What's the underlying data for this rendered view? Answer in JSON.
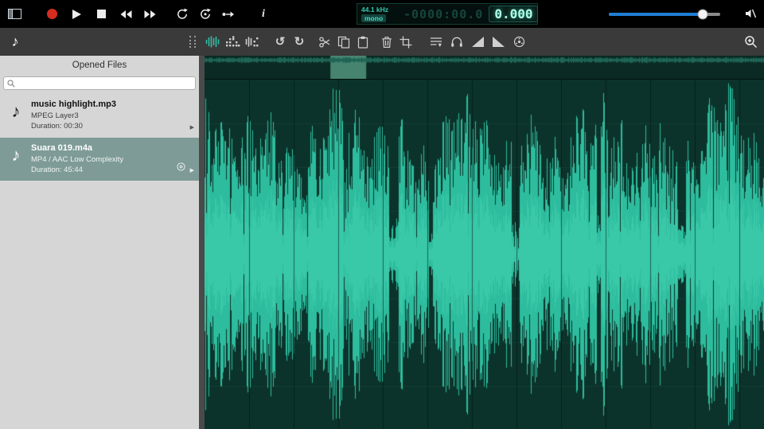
{
  "colors": {
    "accent": "#2fbfa4",
    "record_red": "#d62d20",
    "slider_blue": "#1f7fd4",
    "topbar_bg": "#000000",
    "toolbar2_bg": "#3a3a3a",
    "sidebar_bg": "#d6d6d6",
    "selected_item_bg": "#7e9b97",
    "splitter": "#4a4a4a",
    "wave_bg": "#0c332b",
    "wave_fg": "#2dbd9e",
    "wave_core": "#45d4b2",
    "overview_bg": "#0a2a23",
    "overview_selection": "#47846f",
    "overview_wave": "#1f6455"
  },
  "topbar": {
    "display": {
      "sample_rate": "44.1 kHz",
      "channel_mode": "mono",
      "time_dim": "-0000:00.0",
      "time_bright": "0.000"
    },
    "volume": {
      "level_frac": 0.84
    }
  },
  "toolbar_icons": {
    "music_note": "♪",
    "undo": "↺",
    "redo": "↻",
    "info": "i",
    "expand": "▶"
  },
  "sidebar": {
    "header": "Opened Files",
    "search_placeholder": "",
    "files": [
      {
        "name": "music highlight.mp3",
        "format": "MPEG Layer3",
        "duration": "Duration: 00:30"
      },
      {
        "name": "Suara 019.m4a",
        "format": "MP4 / AAC Low Complexity",
        "duration": "Duration: 45:44"
      }
    ]
  },
  "overview": {
    "selection_start_frac": 0.225,
    "selection_width_frac": 0.064
  }
}
